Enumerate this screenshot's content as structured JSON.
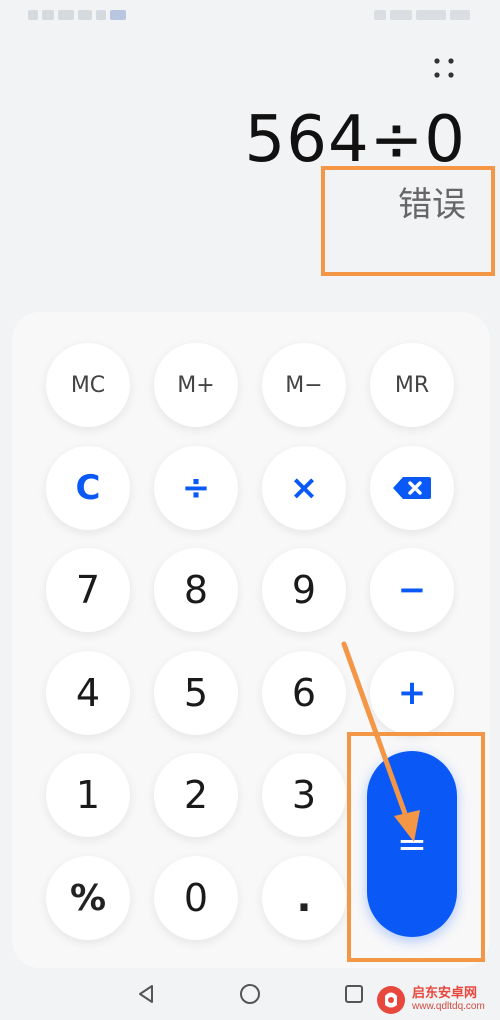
{
  "display": {
    "expression": "564÷0",
    "result": "错误"
  },
  "keys": {
    "mc": "MC",
    "m_plus": "M+",
    "m_minus": "M−",
    "mr": "MR",
    "clear": "C",
    "divide": "÷",
    "multiply": "×",
    "backspace": "backspace-icon",
    "n7": "7",
    "n8": "8",
    "n9": "9",
    "minus": "−",
    "n4": "4",
    "n5": "5",
    "n6": "6",
    "plus": "+",
    "n1": "1",
    "n2": "2",
    "n3": "3",
    "percent": "%",
    "n0": "0",
    "dot": ".",
    "equals": "="
  },
  "navbar": {
    "back": "back-icon",
    "home": "home-icon",
    "recents": "recents-icon"
  },
  "watermark": {
    "title": "启东安卓网",
    "url": "www.qdltdq.com"
  },
  "colors": {
    "accent": "#0a59f7",
    "annotation": "#f39646",
    "background": "#f2f3f5",
    "keypad": "#f8f8f9"
  }
}
